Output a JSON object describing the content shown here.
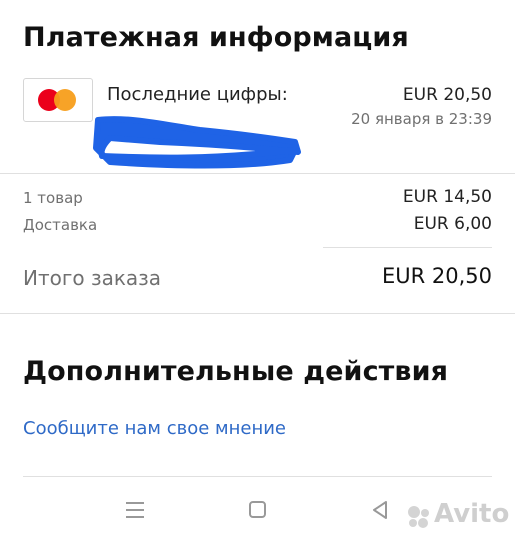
{
  "payment": {
    "title": "Платежная информация",
    "last_digits_label": "Последние цифры:",
    "amount": "EUR 20,50",
    "date": "20 января в 23:39",
    "card_brand_icon": "mastercard-icon"
  },
  "summary": {
    "items_label": "1 товар",
    "items_value": "EUR 14,50",
    "delivery_label": "Доставка",
    "delivery_value": "EUR 6,00",
    "total_label": "Итого заказа",
    "total_value": "EUR 20,50"
  },
  "actions": {
    "title": "Дополнительные действия",
    "feedback_link": "Сообщите нам свое мнение"
  },
  "navbar": {
    "menu_icon": "menu-icon",
    "home_icon": "home-square-icon",
    "back_icon": "back-triangle-icon"
  },
  "watermark": {
    "text": "Avito",
    "icon": "avito-dots-icon"
  },
  "colors": {
    "link": "#2f6ac7",
    "redaction": "#1f63e6",
    "mastercard_red": "#eb001b",
    "mastercard_yellow": "#f79e1b"
  }
}
